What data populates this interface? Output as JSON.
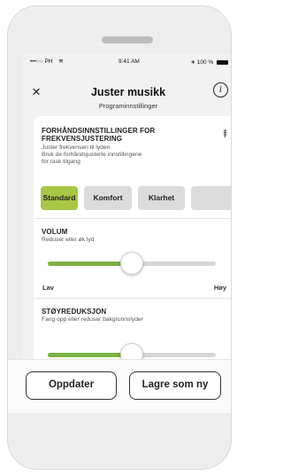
{
  "status_bar": {
    "carrier": "•••○○ PH",
    "wifi": "wifi-icon",
    "time": "9:41 AM",
    "bluetooth": "bluetooth-icon",
    "battery": "100 %"
  },
  "header": {
    "close_icon": "×",
    "title": "Juster musikk",
    "subtitle": "Programinnstillinger",
    "info_icon": "i"
  },
  "presets_section": {
    "title_line1": "FORHÅNDSINNSTILLINGER FOR",
    "title_line2": "FREKVENSJUSTERING",
    "desc_line1": "Juster frekvensen til lyden",
    "desc_line2": "Bruk de forhåndsjusterte innstillingene",
    "desc_line3": "for rask tilgang",
    "tune_icon": "tune-icon",
    "buttons": [
      {
        "label": "Standard",
        "active": true
      },
      {
        "label": "Komfort",
        "active": false
      },
      {
        "label": "Klarhet",
        "active": false
      },
      {
        "label": "",
        "active": false
      }
    ]
  },
  "volume": {
    "title": "VOLUM",
    "desc": "Reduser eller øk lyd",
    "value": 0.5,
    "min_label": "Lav",
    "max_label": "Høy"
  },
  "noise": {
    "title": "STØYREDUKSJON",
    "desc": "Fang opp eller reduser bakgrunnslyder",
    "value": 0.5
  },
  "actions": {
    "update": "Oppdater",
    "save_new": "Lagre som ny"
  },
  "colors": {
    "accent": "#a8c845",
    "slider_fill": "#7cb342"
  }
}
